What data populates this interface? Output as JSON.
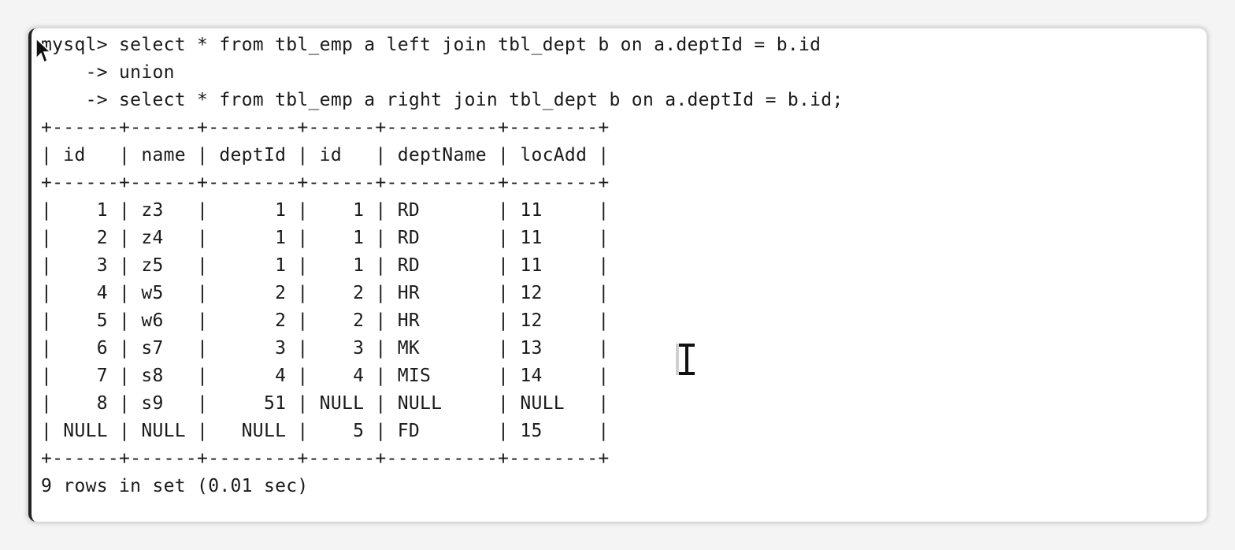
{
  "terminal": {
    "lines": [
      "mysql> select * from tbl_emp a left join tbl_dept b on a.deptId = b.id",
      "    -> union",
      "    -> select * from tbl_emp a right join tbl_dept b on a.deptId = b.id;",
      "+------+------+--------+------+----------+--------+",
      "| id   | name | deptId | id   | deptName | locAdd |",
      "+------+------+--------+------+----------+--------+",
      "|    1 | z3   |      1 |    1 | RD       | 11     |",
      "|    2 | z4   |      1 |    1 | RD       | 11     |",
      "|    3 | z5   |      1 |    1 | RD       | 11     |",
      "|    4 | w5   |      2 |    2 | HR       | 12     |",
      "|    5 | w6   |      2 |    2 | HR       | 12     |",
      "|    6 | s7   |      3 |    3 | MK       | 13     |",
      "|    7 | s8   |      4 |    4 | MIS      | 14     |",
      "|    8 | s9   |     51 | NULL | NULL     | NULL   |",
      "| NULL | NULL |   NULL |    5 | FD       | 15     |",
      "+------+------+--------+------+----------+--------+",
      "9 rows in set (0.01 sec)"
    ]
  },
  "icons": {
    "pointer": "arrow-pointer-icon",
    "text_cursor": "ibeam-cursor-icon"
  },
  "colors": {
    "text": "#1a1a1a",
    "background": "#ffffff"
  }
}
